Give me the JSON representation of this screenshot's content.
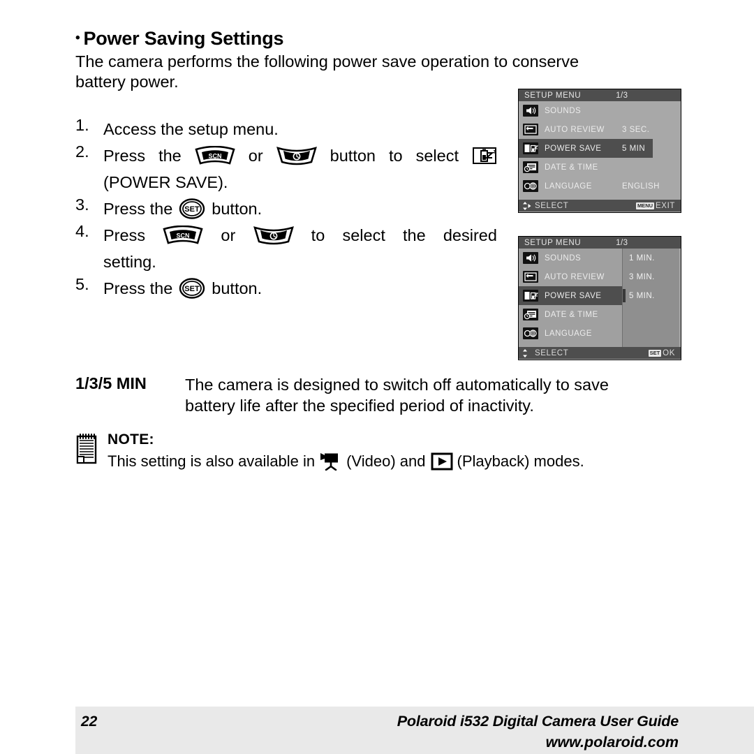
{
  "heading": {
    "bullet": "•",
    "text": "Power Saving Settings"
  },
  "intro": {
    "line1": "The camera performs the following power save operation to conserve",
    "line2": "battery power."
  },
  "steps": [
    {
      "num": "1.",
      "text": "Access the setup menu."
    },
    {
      "num": "2.",
      "w1": "Press",
      "w2": "the",
      "icon1": "scn-button-icon",
      "or": "or",
      "icon2": "self-timer-button-icon",
      "w3": "button",
      "w4": "to",
      "w5": "select",
      "icon3": "power-save-icon",
      "line2": "(POWER SAVE)."
    },
    {
      "num": "3.",
      "w1": "Press the",
      "icon": "set-button-icon",
      "w2": "button."
    },
    {
      "num": "4.",
      "w1": "Press",
      "icon1": "scn-button-icon",
      "or": "or",
      "icon2": "self-timer-button-icon",
      "w2": "to",
      "w3": "select",
      "w4": "the",
      "w5": "desired",
      "line2": "setting."
    },
    {
      "num": "5.",
      "w1": "Press the",
      "icon": "set-button-icon",
      "w2": "button."
    }
  ],
  "min_block": {
    "term": "1/3/5 MIN",
    "desc_line1": "The camera is designed to switch off automatically to save",
    "desc_line2": "battery life after the specified period of inactivity."
  },
  "note": {
    "icon": "notepad-icon",
    "title": "NOTE:",
    "text_before": "This setting is also available in",
    "video_icon": "video-mode-icon",
    "video_label": "(Video) and",
    "playback_icon": "playback-mode-icon",
    "playback_label": "(Playback) modes."
  },
  "lcd_menus": [
    {
      "id": "lcd-1",
      "title": "SETUP MENU",
      "page": "1/3",
      "rows": [
        {
          "icon": "sounds-icon",
          "label": "SOUNDS",
          "value": "",
          "selected": false
        },
        {
          "icon": "auto-review-icon",
          "label": "AUTO REVIEW",
          "value": "3 SEC.",
          "selected": false
        },
        {
          "icon": "power-save-icon",
          "label": "POWER SAVE",
          "value": "5 MIN",
          "selected": true
        },
        {
          "icon": "date-time-icon",
          "label": "DATE & TIME",
          "value": "",
          "selected": false
        },
        {
          "icon": "language-icon",
          "label": "LANGUAGE",
          "value": "ENGLISH",
          "selected": false
        }
      ],
      "footer": {
        "arrows": "up-down-right-arrows-icon",
        "select_label": "SELECT",
        "badge": "MENU",
        "action_label": "EXIT"
      }
    },
    {
      "id": "lcd-2",
      "title": "SETUP MENU",
      "page": "1/3",
      "rows": [
        {
          "icon": "sounds-icon",
          "label": "SOUNDS",
          "value": "",
          "selected": false
        },
        {
          "icon": "auto-review-icon",
          "label": "AUTO REVIEW",
          "value": "",
          "selected": false
        },
        {
          "icon": "power-save-icon",
          "label": "POWER SAVE",
          "value": "",
          "selected": true
        },
        {
          "icon": "date-time-icon",
          "label": "DATE & TIME",
          "value": "",
          "selected": false
        },
        {
          "icon": "language-icon",
          "label": "LANGUAGE",
          "value": "",
          "selected": false
        }
      ],
      "options": [
        {
          "label": "1 MIN.",
          "marked": false
        },
        {
          "label": "3 MIN.",
          "marked": false
        },
        {
          "label": "5 MIN.",
          "marked": true
        },
        {
          "label": "",
          "marked": false
        },
        {
          "label": "",
          "marked": false
        }
      ],
      "footer": {
        "arrows": "up-down-arrows-icon",
        "select_label": "SELECT",
        "badge": "SET",
        "action_label": "OK"
      }
    }
  ],
  "footer": {
    "page_number": "22",
    "guide": "Polaroid i532 Digital Camera User Guide",
    "website": "www.polaroid.com"
  },
  "colors": {
    "lcd_background": "#a8a8a8",
    "lcd_bar": "#4e4e4e",
    "lcd_value_panel": "#8f8f8f",
    "footer_band": "#e9e9e9",
    "text": "#000000"
  }
}
